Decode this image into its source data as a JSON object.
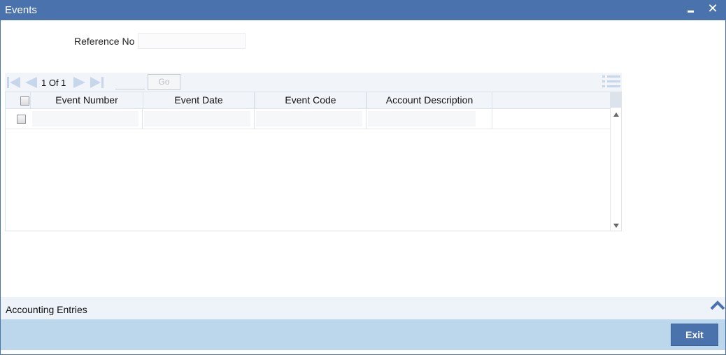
{
  "window": {
    "title": "Events",
    "minimize_icon": "minimize-icon",
    "close_icon": "close-icon",
    "close_glyph": "✕"
  },
  "form": {
    "reference_label": "Reference No",
    "reference_value": ""
  },
  "pager": {
    "page_text": "1 Of 1",
    "page_input": "",
    "go_label": "Go",
    "icons": [
      "first-page-icon",
      "previous-page-icon",
      "next-page-icon",
      "last-page-icon",
      "grid-options-icon"
    ]
  },
  "grid": {
    "columns": [
      "Event Number",
      "Event Date",
      "Event Code",
      "Account Description"
    ],
    "rows": [
      {
        "event_number": "",
        "event_date": "",
        "event_code": "",
        "account_description": ""
      }
    ]
  },
  "accounting": {
    "label": "Accounting Entries",
    "icon": "chevron-up-icon"
  },
  "footer": {
    "exit_label": "Exit"
  },
  "colors": {
    "titlebar": "#4a73ad",
    "footer": "#bcd6ec",
    "header_bg": "#f1f5fa",
    "accent_disabled": "#c7d6ea"
  }
}
